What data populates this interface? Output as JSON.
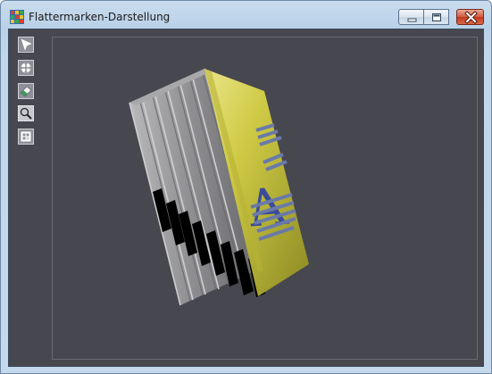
{
  "window": {
    "title": "Flattermarken-Darstellung",
    "icon": "app-grid-icon"
  },
  "controls": {
    "minimize": "minimize-icon",
    "maximize": "maximize-icon",
    "close": "close-icon"
  },
  "toolbar": {
    "tools": [
      {
        "name": "select-tool",
        "icon": "arrow-pointer-icon",
        "active": false
      },
      {
        "name": "rotate-tool",
        "icon": "rotate-cross-icon",
        "active": false
      },
      {
        "name": "eraser-tool",
        "icon": "eraser-icon",
        "active": false
      },
      {
        "name": "zoom-tool",
        "icon": "magnifier-icon",
        "active": true
      },
      {
        "name": "reset-view-tool",
        "icon": "grid-view-icon",
        "active": false
      }
    ]
  },
  "viewport": {
    "object": "book-stack-3d",
    "cover_letter": "A",
    "colors": {
      "background": "#47474f",
      "cover": "#c9c43e",
      "spine": "#8a8a8e",
      "marks": "#000000",
      "letter": "#3b4b9a"
    }
  }
}
